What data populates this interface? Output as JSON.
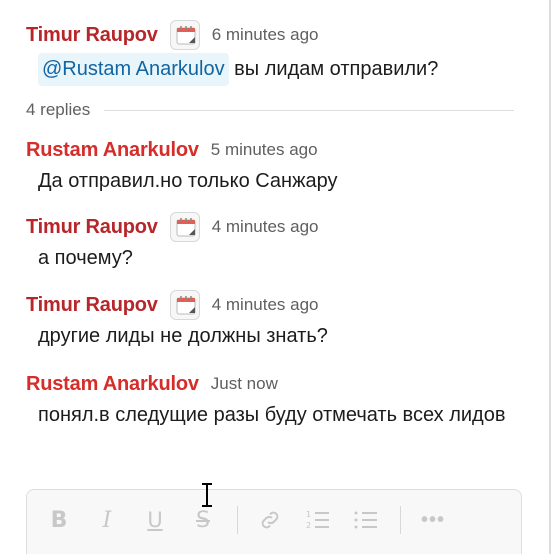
{
  "thread": {
    "parent": {
      "author": "Timur Raupov",
      "status_icon": "calendar-icon",
      "time": "6 minutes ago",
      "mention": "@Rustam Anarkulov",
      "text": " вы лидам отправили?"
    },
    "replies_label": "4 replies",
    "replies": [
      {
        "author": "Rustam Anarkulov",
        "time": "5 minutes ago",
        "text": "Да отправил.но только Санжару"
      },
      {
        "author": "Timur Raupov",
        "status_icon": "calendar-icon",
        "time": "4 minutes ago",
        "text": "а почему?"
      },
      {
        "author": "Timur Raupov",
        "status_icon": "calendar-icon",
        "time": "4 minutes ago",
        "text": "другие лиды не должны знать?"
      },
      {
        "author": "Rustam Anarkulov",
        "time": "Just now",
        "text": "понял.в следущие разы буду отмечать всех лидов"
      }
    ]
  },
  "composer": {
    "toolbar": {
      "bold": "B",
      "italic": "I",
      "underline": "U",
      "strike": "S",
      "more": "•••"
    }
  },
  "colors": {
    "author_timur": "#b7262b",
    "author_rustam": "#d62d2a",
    "mention_bg": "#e8f5fa",
    "mention_text": "#1264a3"
  }
}
